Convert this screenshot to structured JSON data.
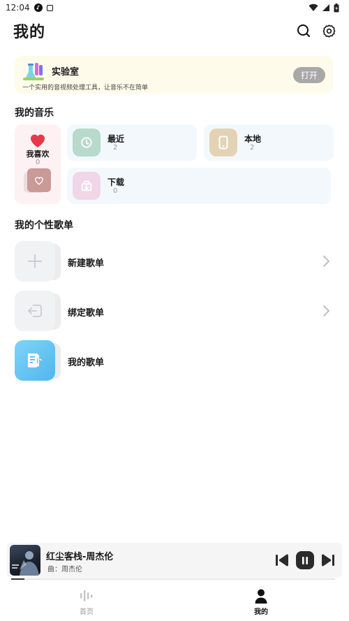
{
  "status_bar": {
    "time": "12:04"
  },
  "header": {
    "title": "我的"
  },
  "lab": {
    "title": "实验室",
    "subtitle": "一个实用的音视频处理工具，让音乐不在简单",
    "open_label": "打开"
  },
  "my_music": {
    "section_title": "我的音乐",
    "favorites": {
      "label": "我喜欢",
      "count": "0"
    },
    "tiles": [
      {
        "label": "最近",
        "count": "2",
        "icon": "clock-icon",
        "color": "#b7dacb"
      },
      {
        "label": "本地",
        "count": "2",
        "icon": "phone-icon",
        "color": "#e3d3b4"
      },
      {
        "label": "下载",
        "count": "0",
        "icon": "download-icon",
        "color": "#f1d6e8"
      }
    ]
  },
  "playlists": {
    "section_title": "我的个性歌单",
    "items": [
      {
        "label": "新建歌单",
        "icon": "plus-icon"
      },
      {
        "label": "绑定歌单",
        "icon": "import-icon"
      },
      {
        "label": "我的歌单",
        "icon": "music-list-icon"
      }
    ]
  },
  "player": {
    "title": "红尘客栈-周杰伦",
    "subtitle": "曲：周杰伦",
    "progress": 0.04
  },
  "tabbar": {
    "tabs": [
      {
        "label": "首页",
        "icon": "equalizer-icon",
        "active": false
      },
      {
        "label": "我的",
        "icon": "person-icon",
        "active": true
      }
    ]
  },
  "colors": {
    "accent": "#2b2b2b",
    "heart": "#e5394b",
    "lab_bg": "#fffbea",
    "open_button": "#a8a8a8"
  }
}
